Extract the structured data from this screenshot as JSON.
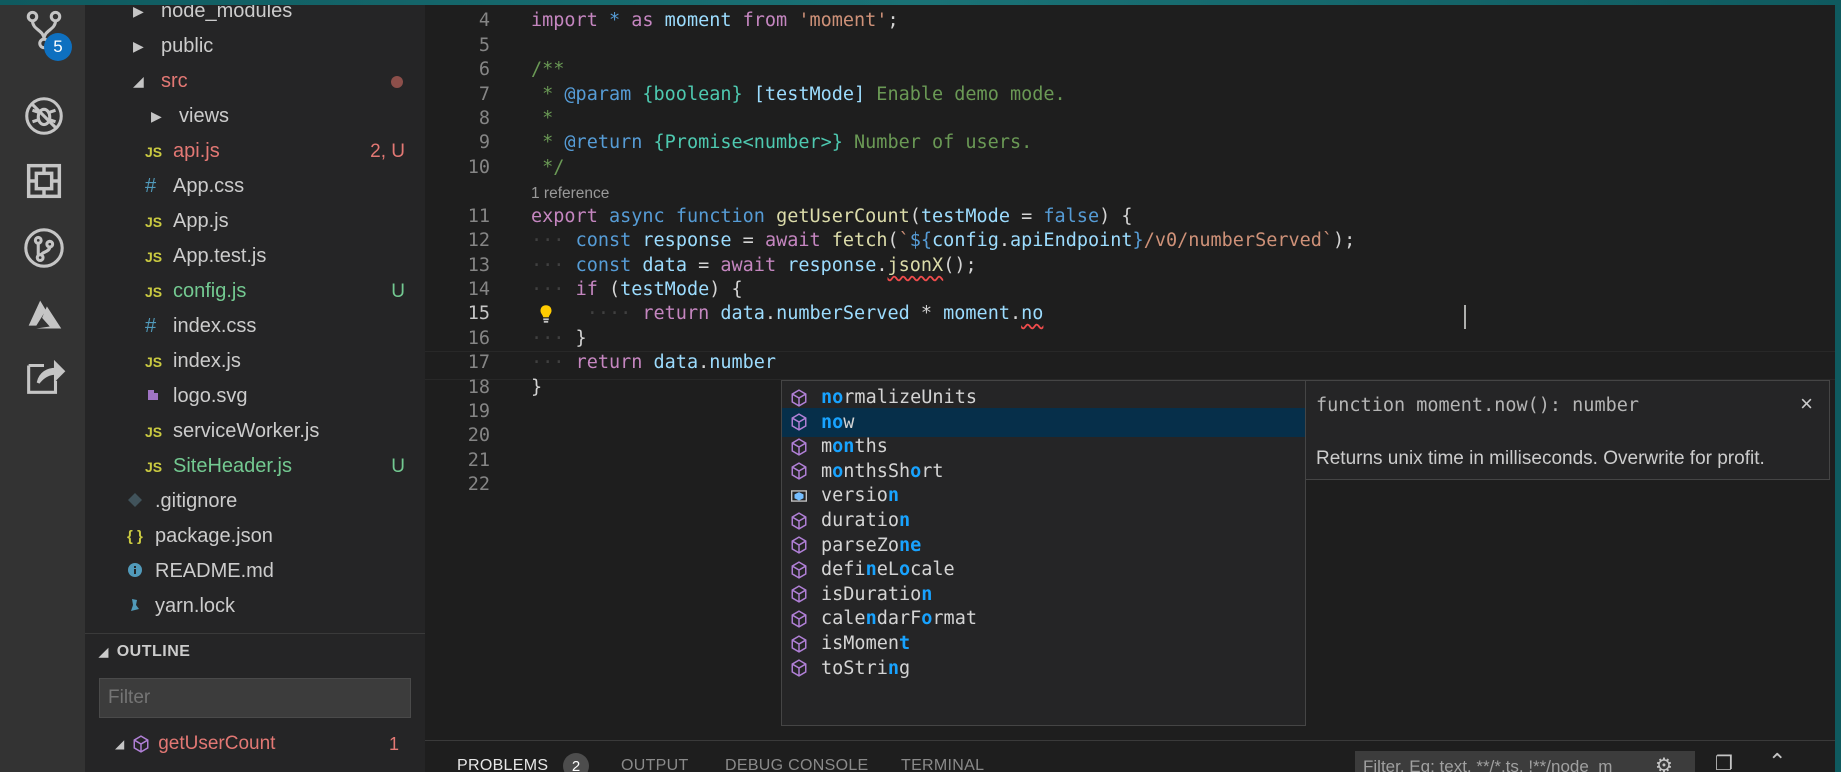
{
  "activity_bar": {
    "scm_badge": "5",
    "icons": [
      "source-control-icon",
      "debug-icon",
      "extensions-icon",
      "git-lens-icon",
      "azure-icon",
      "live-share-icon"
    ]
  },
  "explorer": {
    "rows": [
      {
        "label": "node_modules",
        "kind": "folder",
        "indent": 1,
        "status": ""
      },
      {
        "label": "public",
        "kind": "folder",
        "indent": 1,
        "status": ""
      },
      {
        "label": "src",
        "kind": "folder-open",
        "indent": 1,
        "status": "dot"
      },
      {
        "label": "views",
        "kind": "folder",
        "indent": 2,
        "status": ""
      },
      {
        "label": "api.js",
        "kind": "js",
        "indent": 2,
        "status": "2, U"
      },
      {
        "label": "App.css",
        "kind": "css",
        "indent": 2,
        "status": ""
      },
      {
        "label": "App.js",
        "kind": "js",
        "indent": 2,
        "status": ""
      },
      {
        "label": "App.test.js",
        "kind": "js",
        "indent": 2,
        "status": ""
      },
      {
        "label": "config.js",
        "kind": "js",
        "indent": 2,
        "status": "U"
      },
      {
        "label": "index.css",
        "kind": "css",
        "indent": 2,
        "status": ""
      },
      {
        "label": "index.js",
        "kind": "js",
        "indent": 2,
        "status": ""
      },
      {
        "label": "logo.svg",
        "kind": "svg",
        "indent": 2,
        "status": ""
      },
      {
        "label": "serviceWorker.js",
        "kind": "js",
        "indent": 2,
        "status": ""
      },
      {
        "label": "SiteHeader.js",
        "kind": "js",
        "indent": 2,
        "status": "U"
      },
      {
        "label": ".gitignore",
        "kind": "git",
        "indent": 1,
        "status": ""
      },
      {
        "label": "package.json",
        "kind": "json",
        "indent": 1,
        "status": ""
      },
      {
        "label": "README.md",
        "kind": "info",
        "indent": 1,
        "status": ""
      },
      {
        "label": "yarn.lock",
        "kind": "yarn",
        "indent": 1,
        "status": ""
      }
    ],
    "outline_title": "OUTLINE",
    "outline_filter_placeholder": "Filter",
    "outline_item": "getUserCount",
    "outline_item_count": "1",
    "js_icon": "JS",
    "css_icon": "#",
    "json_icon": "{ }"
  },
  "editor": {
    "codelens": "1 reference",
    "current_line": "15",
    "line_numbers": [
      "4",
      "5",
      "6",
      "7",
      "8",
      "9",
      "10",
      "11",
      "12",
      "13",
      "14",
      "15",
      "16",
      "17",
      "18",
      "19",
      "20",
      "21",
      "22"
    ]
  },
  "suggest": {
    "items": [
      {
        "text": "normalizeUnits",
        "match": [
          0,
          1
        ],
        "icon": "method-icon"
      },
      {
        "text": "now",
        "match": [
          0,
          1
        ],
        "icon": "method-icon",
        "selected": true
      },
      {
        "text": "months",
        "match": [
          1,
          2
        ],
        "icon": "method-icon"
      },
      {
        "text": "monthsShort",
        "match": [
          1,
          8
        ],
        "icon": "method-icon"
      },
      {
        "text": "version",
        "match": [
          6
        ],
        "icon": "field-icon"
      },
      {
        "text": "duration",
        "match": [
          7
        ],
        "icon": "method-icon"
      },
      {
        "text": "parseZone",
        "match": [
          7,
          8
        ],
        "icon": "method-icon"
      },
      {
        "text": "defineLocale",
        "match": [
          4,
          7
        ],
        "icon": "method-icon"
      },
      {
        "text": "isDuration",
        "match": [
          9
        ],
        "icon": "method-icon"
      },
      {
        "text": "calendarFormat",
        "match": [
          4,
          9
        ],
        "icon": "method-icon"
      },
      {
        "text": "isMoment",
        "match": [
          7
        ],
        "icon": "method-icon"
      },
      {
        "text": "toString",
        "match": [
          6
        ],
        "icon": "method-icon"
      }
    ],
    "details_signature": "function moment.now(): number",
    "details_doc": "Returns unix time in milliseconds. Overwrite for profit.",
    "details_close": "×"
  },
  "panel": {
    "tabs": [
      "PROBLEMS",
      "OUTPUT",
      "DEBUG CONSOLE",
      "TERMINAL"
    ],
    "problems_count": "2",
    "filter_placeholder": "Filter. Eg: text, **/*.ts, !**/node_m"
  },
  "colors": {
    "accent": "#0e70c0",
    "selection": "#062f4a",
    "match": "#18a3ff",
    "untracked": "#73c991",
    "modified": "#e37874"
  }
}
